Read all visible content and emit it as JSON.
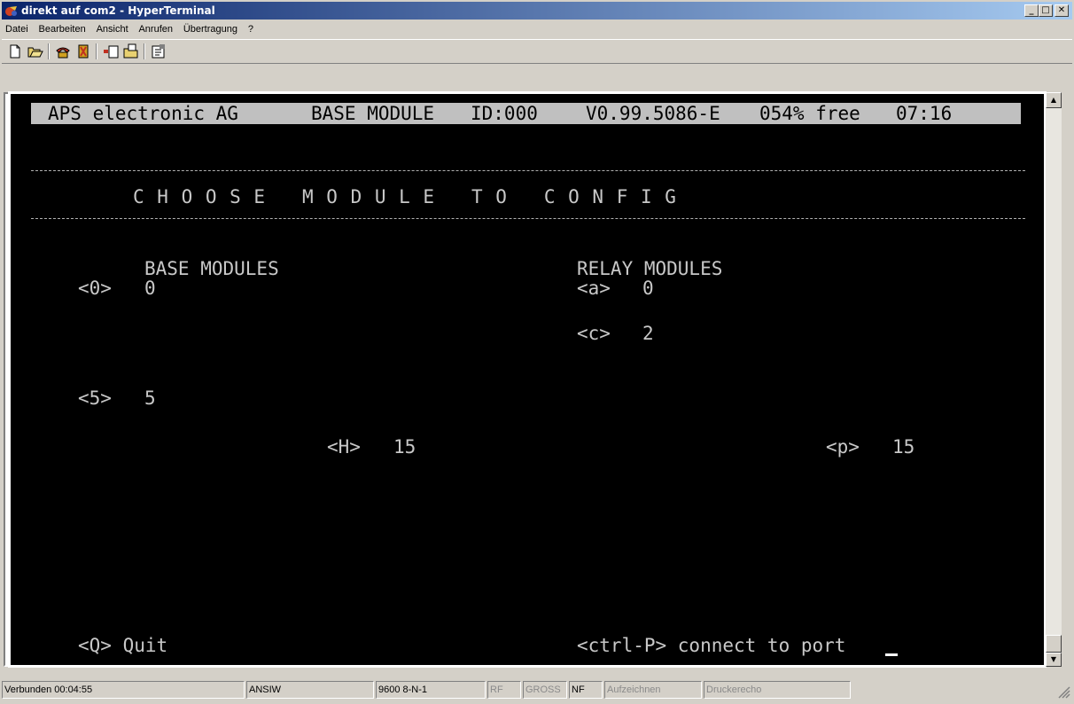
{
  "window": {
    "title": "direkt auf com2 - HyperTerminal",
    "buttons": {
      "minimize": "_",
      "maximize": "□",
      "close": "✕"
    }
  },
  "menu": [
    "Datei",
    "Bearbeiten",
    "Ansicht",
    "Anrufen",
    "Übertragung",
    "?"
  ],
  "toolbar": [
    "new-icon",
    "open-icon",
    "connect-phone-icon",
    "disconnect-phone-icon",
    "send-icon",
    "receive-icon",
    "properties-icon"
  ],
  "terminal": {
    "header": {
      "company": "APS electronic AG",
      "module": "BASE MODULE",
      "id": "ID:000",
      "version": "V0.99.5086-E",
      "free": "054% free",
      "time": "07:16"
    },
    "heading": "C H O O S E   M O D U L E   T O   C O N F I G",
    "base_modules": {
      "label": "BASE MODULES",
      "items": [
        {
          "key": "<0>",
          "value": "0"
        },
        {
          "key": "<5>",
          "value": "5"
        },
        {
          "key": "<H>",
          "value": "15"
        }
      ]
    },
    "relay_modules": {
      "label": "RELAY MODULES",
      "items": [
        {
          "key": "<a>",
          "value": "0"
        },
        {
          "key": "<c>",
          "value": "2"
        },
        {
          "key": "<p>",
          "value": "15"
        }
      ]
    },
    "quit": "<Q> Quit",
    "connect": "<ctrl-P> connect to port"
  },
  "statusbar": {
    "connected": "Verbunden 00:04:55",
    "emulation": "ANSIW",
    "settings": "9600 8-N-1",
    "rf": "RF",
    "gross": "GROSS",
    "nf": "NF",
    "record": "Aufzeichnen",
    "print_echo": "Druckerecho"
  }
}
